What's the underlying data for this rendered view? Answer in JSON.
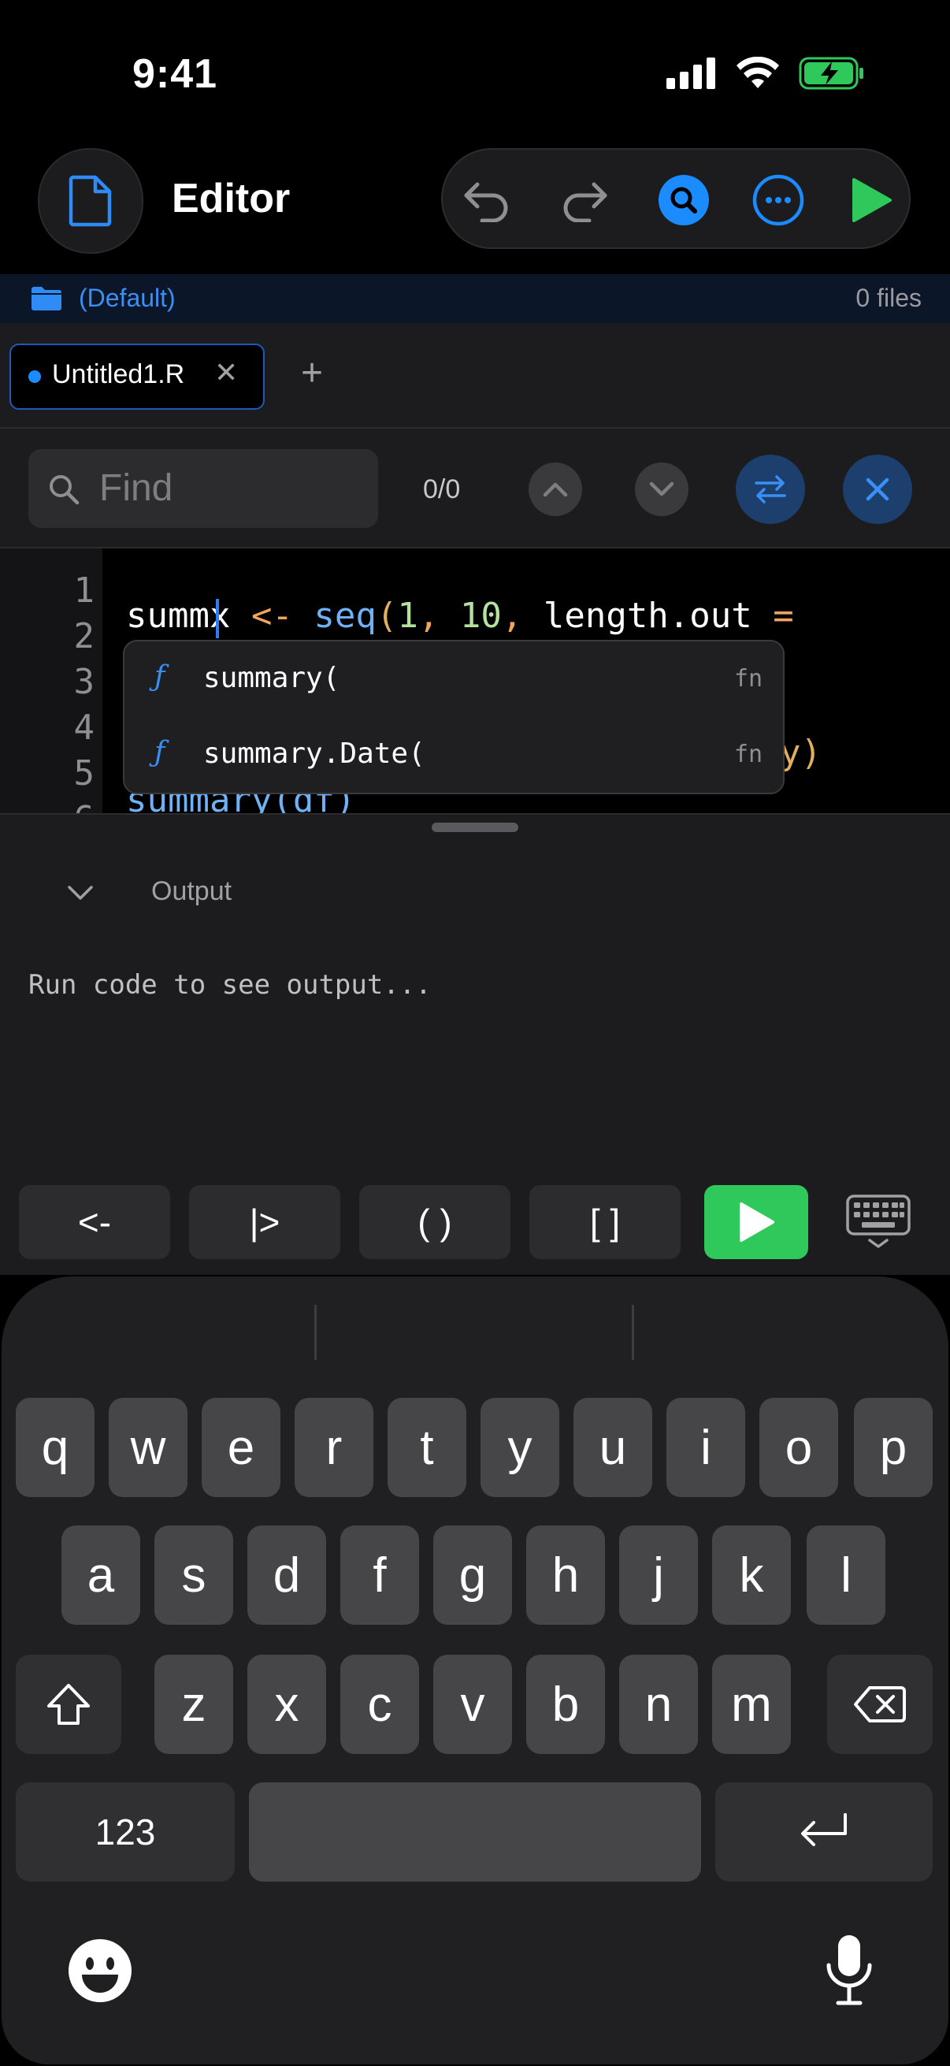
{
  "status_bar": {
    "time": "9:41"
  },
  "header": {
    "title": "Editor",
    "icons": [
      "file-icon",
      "undo-icon",
      "redo-icon",
      "search-icon",
      "more-icon",
      "play-icon"
    ]
  },
  "project": {
    "name": "(Default)",
    "file_count": "0 files"
  },
  "tabs": {
    "items": [
      {
        "label": "Untitled1.R"
      }
    ],
    "close_glyph": "✕",
    "add_glyph": "+"
  },
  "find": {
    "placeholder": "Find",
    "count": "0/0"
  },
  "editor": {
    "line_numbers": [
      "1",
      "2",
      "3",
      "4",
      "5",
      "6"
    ],
    "line2": {
      "ident": "summx",
      "op": " <- ",
      "fn": "seq",
      "open": "(",
      "a1": "1",
      "sep1": ", ",
      "a2": "10",
      "sep2": ", ",
      "arg": "length.out",
      "eq": " ="
    },
    "line5_tail": "y)",
    "line6_partial": "summary(df)"
  },
  "autocomplete": {
    "items": [
      {
        "icon": "ƒ",
        "label": "summary(",
        "kind": "fn"
      },
      {
        "icon": "ƒ",
        "label": "summary.Date(",
        "kind": "fn"
      }
    ]
  },
  "output": {
    "title": "Output",
    "placeholder": "Run code to see output..."
  },
  "shortcuts": {
    "assign": "<-",
    "pipe": "|>",
    "parens": "( )",
    "brackets": "[ ]"
  },
  "keyboard": {
    "row1": [
      "q",
      "w",
      "e",
      "r",
      "t",
      "y",
      "u",
      "i",
      "o",
      "p"
    ],
    "row2": [
      "a",
      "s",
      "d",
      "f",
      "g",
      "h",
      "j",
      "k",
      "l"
    ],
    "row3": [
      "z",
      "x",
      "c",
      "v",
      "b",
      "n",
      "m"
    ],
    "numbers_key": "123"
  },
  "colors": {
    "accent": "#1a8cff",
    "run_green": "#2fc85a",
    "background": "#000000"
  }
}
